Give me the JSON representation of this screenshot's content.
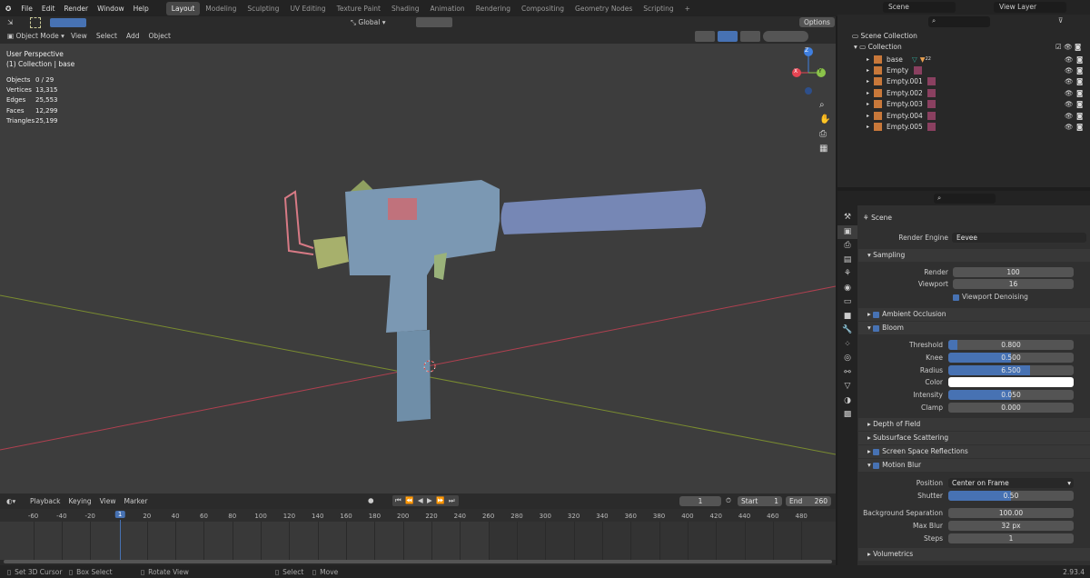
{
  "topbar": {
    "menus": [
      "File",
      "Edit",
      "Render",
      "Window",
      "Help"
    ],
    "workspaces": [
      "Layout",
      "Modeling",
      "Sculpting",
      "UV Editing",
      "Texture Paint",
      "Shading",
      "Animation",
      "Rendering",
      "Compositing",
      "Geometry Nodes",
      "Scripting",
      "+"
    ],
    "active_workspace": "Layout",
    "scene": "Scene",
    "view_layer": "View Layer"
  },
  "viewport": {
    "transform_orientation": "Global",
    "options": "Options",
    "mode": "Object Mode",
    "menus": [
      "View",
      "Select",
      "Add",
      "Object"
    ],
    "perspective": "User Perspective",
    "collection_info": "(1) Collection | base",
    "stats": [
      [
        "Objects",
        "0 / 29"
      ],
      [
        "Vertices",
        "13,315"
      ],
      [
        "Edges",
        "25,553"
      ],
      [
        "Faces",
        "12,299"
      ],
      [
        "Triangles",
        "25,199"
      ]
    ],
    "gizmo": {
      "x": "X",
      "y": "Y",
      "z": "Z"
    },
    "colors": {
      "x": "#e64553",
      "y": "#8bc34a",
      "z": "#3f7fe0",
      "model": "#6f8ea8"
    }
  },
  "outliner": {
    "root": "Scene Collection",
    "collection": "Collection",
    "items": [
      {
        "name": "base",
        "type": "mesh"
      },
      {
        "name": "Empty",
        "type": "empty"
      },
      {
        "name": "Empty.001",
        "type": "empty"
      },
      {
        "name": "Empty.002",
        "type": "empty"
      },
      {
        "name": "Empty.003",
        "type": "empty"
      },
      {
        "name": "Empty.004",
        "type": "empty"
      },
      {
        "name": "Empty.005",
        "type": "empty"
      }
    ],
    "modifier_count": "22"
  },
  "properties": {
    "context": "Scene",
    "render_engine_label": "Render Engine",
    "render_engine": "Eevee",
    "sampling": {
      "title": "Sampling",
      "render_label": "Render",
      "render": "100",
      "viewport_label": "Viewport",
      "viewport": "16",
      "denoise": "Viewport Denoising"
    },
    "ao": "Ambient Occlusion",
    "bloom": {
      "title": "Bloom",
      "fields": [
        {
          "label": "Threshold",
          "value": "0.800",
          "fill": 0.07
        },
        {
          "label": "Knee",
          "value": "0.500",
          "fill": 0.5
        },
        {
          "label": "Radius",
          "value": "6.500",
          "fill": 0.65
        },
        {
          "label": "Color",
          "value": "",
          "fill": 0,
          "color": "#ffffff"
        },
        {
          "label": "Intensity",
          "value": "0.050",
          "fill": 0.5
        },
        {
          "label": "Clamp",
          "value": "0.000",
          "fill": 0
        }
      ]
    },
    "dof": "Depth of Field",
    "sss": "Subsurface Scattering",
    "ssr": "Screen Space Reflections",
    "motion_blur": {
      "title": "Motion Blur",
      "position_label": "Position",
      "position": "Center on Frame",
      "shutter_label": "Shutter",
      "shutter": "0.50",
      "shutter_fill": 0.5,
      "fields": [
        {
          "label": "Background Separation",
          "value": "100.00"
        },
        {
          "label": "Max Blur",
          "value": "32 px"
        },
        {
          "label": "Steps",
          "value": "1"
        }
      ]
    },
    "volumetrics": "Volumetrics"
  },
  "timeline": {
    "menus": [
      "Playback",
      "Keying",
      "View",
      "Marker"
    ],
    "current_frame": "1",
    "start_label": "Start",
    "start": "1",
    "end_label": "End",
    "end": "260",
    "ticks": [
      "-60",
      "-40",
      "-20",
      "1",
      "20",
      "40",
      "60",
      "80",
      "100",
      "120",
      "140",
      "160",
      "180",
      "200",
      "220",
      "240",
      "260",
      "280",
      "300",
      "320",
      "340",
      "360",
      "380",
      "400",
      "420",
      "440",
      "460",
      "480"
    ]
  },
  "status": {
    "items": [
      "Set 3D Cursor",
      "Box Select",
      "Rotate View",
      "Select",
      "Move"
    ],
    "version": "2.93.4"
  }
}
